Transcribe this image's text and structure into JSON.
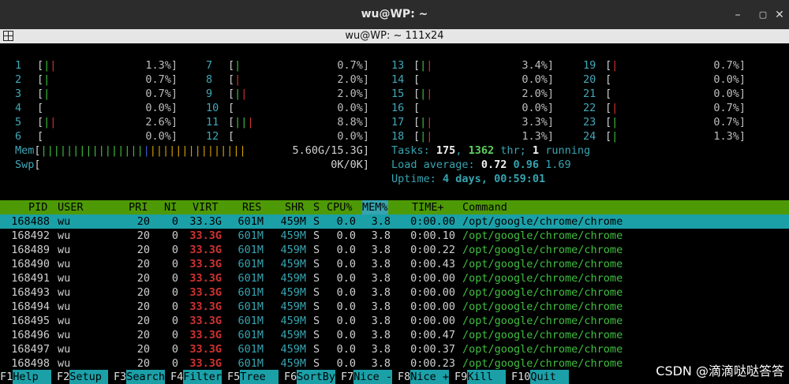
{
  "window": {
    "title": "wu@WP: ~",
    "tab_title": "wu@WP: ~ 111x24"
  },
  "cpus": [
    {
      "n": "1",
      "bars": [
        [
          "g",
          "|"
        ],
        [
          "r",
          "|"
        ]
      ],
      "pct": "1.3%]"
    },
    {
      "n": "2",
      "bars": [
        [
          "g",
          "|"
        ]
      ],
      "pct": "0.7%]"
    },
    {
      "n": "3",
      "bars": [
        [
          "g",
          "|"
        ]
      ],
      "pct": "0.7%]"
    },
    {
      "n": "4",
      "bars": [],
      "pct": "0.0%]"
    },
    {
      "n": "5",
      "bars": [
        [
          "g",
          "|"
        ],
        [
          "r",
          "|"
        ]
      ],
      "pct": "2.6%]"
    },
    {
      "n": "6",
      "bars": [],
      "pct": "0.0%]"
    },
    {
      "n": "7",
      "bars": [
        [
          "g",
          "|"
        ]
      ],
      "pct": "0.7%]"
    },
    {
      "n": "8",
      "bars": [
        [
          "r",
          "|"
        ]
      ],
      "pct": "2.0%]"
    },
    {
      "n": "9",
      "bars": [
        [
          "g",
          "|"
        ],
        [
          "r",
          "|"
        ]
      ],
      "pct": "2.0%]"
    },
    {
      "n": "10",
      "bars": [],
      "pct": "0.0%]"
    },
    {
      "n": "11",
      "bars": [
        [
          "g",
          "|"
        ],
        [
          "g",
          "|"
        ],
        [
          "r",
          "|"
        ]
      ],
      "pct": "8.8%]"
    },
    {
      "n": "12",
      "bars": [],
      "pct": "0.0%]"
    },
    {
      "n": "13",
      "bars": [
        [
          "g",
          "|"
        ],
        [
          "r",
          "|"
        ]
      ],
      "pct": "3.4%]"
    },
    {
      "n": "14",
      "bars": [],
      "pct": "0.0%]"
    },
    {
      "n": "15",
      "bars": [
        [
          "g",
          "|"
        ],
        [
          "r",
          "|"
        ]
      ],
      "pct": "2.0%]"
    },
    {
      "n": "16",
      "bars": [],
      "pct": "0.0%]"
    },
    {
      "n": "17",
      "bars": [
        [
          "g",
          "|"
        ],
        [
          "r",
          "|"
        ]
      ],
      "pct": "3.3%]"
    },
    {
      "n": "18",
      "bars": [
        [
          "g",
          "|"
        ],
        [
          "r",
          "|"
        ]
      ],
      "pct": "1.3%]"
    },
    {
      "n": "19",
      "bars": [
        [
          "r",
          "|"
        ]
      ],
      "pct": "0.7%]"
    },
    {
      "n": "20",
      "bars": [],
      "pct": "0.0%]"
    },
    {
      "n": "21",
      "bars": [],
      "pct": "0.0%]"
    },
    {
      "n": "22",
      "bars": [
        [
          "r",
          "|"
        ]
      ],
      "pct": "0.7%]"
    },
    {
      "n": "23",
      "bars": [
        [
          "g",
          "|"
        ]
      ],
      "pct": "0.7%]"
    },
    {
      "n": "24",
      "bars": [
        [
          "g",
          "|"
        ]
      ],
      "pct": "1.3%]"
    }
  ],
  "mem": {
    "label": "Mem",
    "green": "||||||||||||||||",
    "blue": "|",
    "yellow": "|||||||||||||||",
    "value": "5.60G/15.3G]"
  },
  "swp": {
    "label": "Swp",
    "value": "0K/0K]"
  },
  "tasks": {
    "label": "Tasks:",
    "tasks": "175",
    "sep1": ",",
    "thr": "1362",
    "thr_label": "thr;",
    "running": "1",
    "running_label": "running"
  },
  "load": {
    "label": "Load average:",
    "v1": "0.72",
    "v2": "0.96",
    "v3": "1.69"
  },
  "uptime": {
    "label": "Uptime:",
    "value": "4 days, 00:59:01"
  },
  "columns": {
    "pid": "PID",
    "user": "USER",
    "pri": "PRI",
    "ni": "NI",
    "virt": "VIRT",
    "res": "RES",
    "shr": "SHR",
    "s": "S",
    "cpu": "CPU%",
    "mem": "MEM%",
    "time": "TIME+",
    "cmd": "Command"
  },
  "processes": [
    {
      "pid": "168488",
      "user": "wu",
      "pri": "20",
      "ni": "0",
      "virt": "33.3G",
      "res": "601M",
      "shr": "459M",
      "s": "S",
      "cpu": "0.0",
      "mem": "3.8",
      "time": "0:00.00",
      "cmd": "/opt/google/chrome/chrome"
    },
    {
      "pid": "168492",
      "user": "wu",
      "pri": "20",
      "ni": "0",
      "virt": "33.3G",
      "res": "601M",
      "shr": "459M",
      "s": "S",
      "cpu": "0.0",
      "mem": "3.8",
      "time": "0:00.10",
      "cmd": "/opt/google/chrome/chrome"
    },
    {
      "pid": "168489",
      "user": "wu",
      "pri": "20",
      "ni": "0",
      "virt": "33.3G",
      "res": "601M",
      "shr": "459M",
      "s": "S",
      "cpu": "0.0",
      "mem": "3.8",
      "time": "0:00.22",
      "cmd": "/opt/google/chrome/chrome"
    },
    {
      "pid": "168490",
      "user": "wu",
      "pri": "20",
      "ni": "0",
      "virt": "33.3G",
      "res": "601M",
      "shr": "459M",
      "s": "S",
      "cpu": "0.0",
      "mem": "3.8",
      "time": "0:00.43",
      "cmd": "/opt/google/chrome/chrome"
    },
    {
      "pid": "168491",
      "user": "wu",
      "pri": "20",
      "ni": "0",
      "virt": "33.3G",
      "res": "601M",
      "shr": "459M",
      "s": "S",
      "cpu": "0.0",
      "mem": "3.8",
      "time": "0:00.00",
      "cmd": "/opt/google/chrome/chrome"
    },
    {
      "pid": "168493",
      "user": "wu",
      "pri": "20",
      "ni": "0",
      "virt": "33.3G",
      "res": "601M",
      "shr": "459M",
      "s": "S",
      "cpu": "0.0",
      "mem": "3.8",
      "time": "0:00.00",
      "cmd": "/opt/google/chrome/chrome"
    },
    {
      "pid": "168494",
      "user": "wu",
      "pri": "20",
      "ni": "0",
      "virt": "33.3G",
      "res": "601M",
      "shr": "459M",
      "s": "S",
      "cpu": "0.0",
      "mem": "3.8",
      "time": "0:00.00",
      "cmd": "/opt/google/chrome/chrome"
    },
    {
      "pid": "168495",
      "user": "wu",
      "pri": "20",
      "ni": "0",
      "virt": "33.3G",
      "res": "601M",
      "shr": "459M",
      "s": "S",
      "cpu": "0.0",
      "mem": "3.8",
      "time": "0:00.00",
      "cmd": "/opt/google/chrome/chrome"
    },
    {
      "pid": "168496",
      "user": "wu",
      "pri": "20",
      "ni": "0",
      "virt": "33.3G",
      "res": "601M",
      "shr": "459M",
      "s": "S",
      "cpu": "0.0",
      "mem": "3.8",
      "time": "0:00.47",
      "cmd": "/opt/google/chrome/chrome"
    },
    {
      "pid": "168497",
      "user": "wu",
      "pri": "20",
      "ni": "0",
      "virt": "33.3G",
      "res": "601M",
      "shr": "459M",
      "s": "S",
      "cpu": "0.0",
      "mem": "3.8",
      "time": "0:00.37",
      "cmd": "/opt/google/chrome/chrome"
    },
    {
      "pid": "168498",
      "user": "wu",
      "pri": "20",
      "ni": "0",
      "virt": "33.3G",
      "res": "601M",
      "shr": "459M",
      "s": "S",
      "cpu": "0.0",
      "mem": "3.8",
      "time": "0:00.23",
      "cmd": "/opt/google/chrome/chrome"
    }
  ],
  "fkeys": [
    {
      "key": "F1",
      "label": "Help  "
    },
    {
      "key": "F2",
      "label": "Setup "
    },
    {
      "key": "F3",
      "label": "Search"
    },
    {
      "key": "F4",
      "label": "Filter"
    },
    {
      "key": "F5",
      "label": "Tree  "
    },
    {
      "key": "F6",
      "label": "SortBy"
    },
    {
      "key": "F7",
      "label": "Nice -"
    },
    {
      "key": "F8",
      "label": "Nice +"
    },
    {
      "key": "F9",
      "label": "Kill  "
    },
    {
      "key": "F10",
      "label": "Quit  "
    }
  ],
  "watermark": "CSDN @滴滴哒哒答答",
  "colors": {
    "teal": "#1ba0a8",
    "header_green": "#4e9a06",
    "bar_green": "#3fbf3f",
    "bar_red": "#d23232"
  }
}
